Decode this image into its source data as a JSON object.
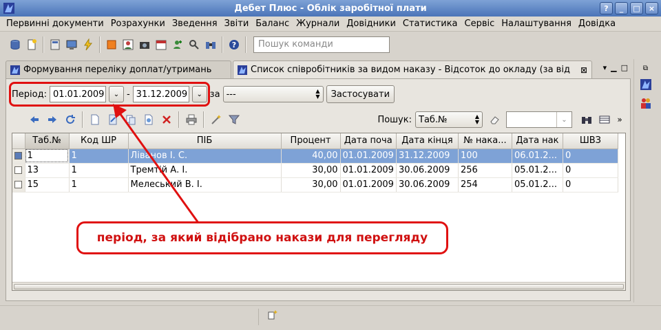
{
  "window": {
    "title": "Дебет Плюс - Облік заробітної плати",
    "buttons": [
      "?",
      "_",
      "□",
      "×"
    ]
  },
  "menu": [
    "Первинні документи",
    "Розрахунки",
    "Зведення",
    "Звіти",
    "Баланс",
    "Журнали",
    "Довідники",
    "Статистика",
    "Сервіс",
    "Налаштування",
    "Довідка"
  ],
  "toolbar": {
    "search_placeholder": "Пошук команди"
  },
  "tabs": [
    {
      "label": "Формування переліку доплат/утримань",
      "active": false
    },
    {
      "label": "Список співробітників за видом наказу - Відсоток до окладу (за від",
      "active": true
    }
  ],
  "filter": {
    "period_label": "Період:",
    "date_from": "01.01.2009",
    "dash": "-",
    "date_to": "31.12.2009",
    "za_label": "за",
    "za_value": "---",
    "apply_label": "Застосувати"
  },
  "gridbar": {
    "search_label": "Пошук:",
    "search_field": "Таб.№",
    "search_value": ""
  },
  "table": {
    "columns": [
      "Таб.№",
      "Код ШР",
      "ПІБ",
      "Процент",
      "Дата поча",
      "Дата кінця",
      "№ нака...",
      "Дата нак",
      "ШВЗ"
    ],
    "rows": [
      {
        "tab": "1",
        "kod": "1",
        "pib": "Ліванов І. С.",
        "proc": "40,00",
        "start": "01.01.2009",
        "end": "31.12.2009",
        "num": "100",
        "date": "06.01.2...",
        "shvz": "0",
        "selected": true
      },
      {
        "tab": "13",
        "kod": "1",
        "pib": "Тремтій А. І.",
        "proc": "30,00",
        "start": "01.01.2009",
        "end": "30.06.2009",
        "num": "256",
        "date": "05.01.2...",
        "shvz": "0",
        "selected": false
      },
      {
        "tab": "15",
        "kod": "1",
        "pib": "Мелеський В. І.",
        "proc": "30,00",
        "start": "01.01.2009",
        "end": "30.06.2009",
        "num": "254",
        "date": "05.01.2...",
        "shvz": "0",
        "selected": false
      }
    ]
  },
  "annotation": {
    "text": "період, за який відібрано накази для перегляду",
    "color": "#e01010"
  },
  "colors": {
    "title_bg": "#4a74b8",
    "selection": "#7ea2d6",
    "window_bg": "#d7d3cc"
  }
}
